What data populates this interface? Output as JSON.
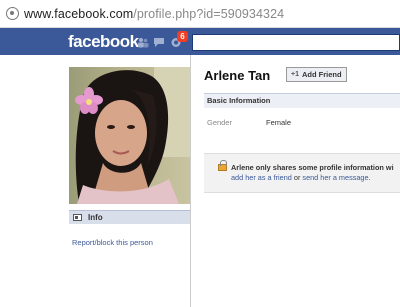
{
  "browser": {
    "url_host": "www.facebook.com",
    "url_path": "/profile.php?id=590934324"
  },
  "header": {
    "logo": "facebook",
    "notifications_count": "6"
  },
  "profile": {
    "name": "Arlene Tan",
    "add_friend_label": "Add Friend",
    "info_tab_label": "Info",
    "report_link": "Report/block this person"
  },
  "basic_info": {
    "section_title": "Basic Information",
    "fields": [
      {
        "label": "Gender",
        "value": "Female"
      }
    ]
  },
  "privacy_notice": {
    "line1": "Arlene only shares some profile information wi",
    "link1": "add her as a friend",
    "connector": "or",
    "link2": "send her a message",
    "end": "."
  },
  "colors": {
    "brand": "#3b5998",
    "badge": "#f03d25"
  },
  "icons": [
    "friends-jewel-icon",
    "messages-jewel-icon",
    "notifications-jewel-icon",
    "info-icon",
    "lock-icon",
    "page-icon"
  ]
}
